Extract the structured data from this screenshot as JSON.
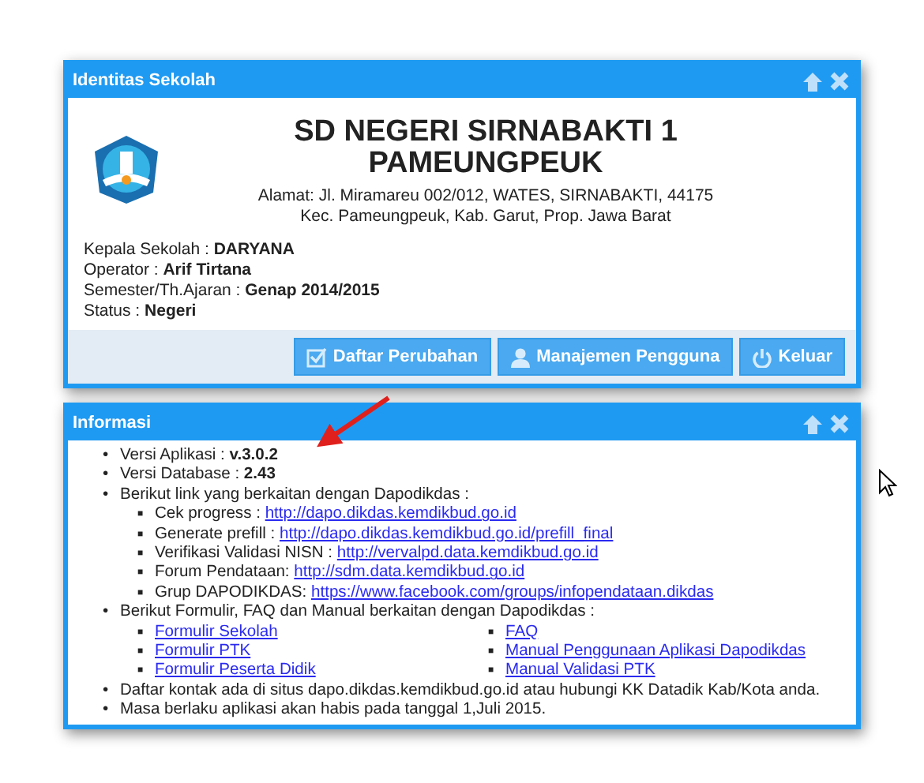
{
  "school_panel": {
    "title": "Identitas Sekolah",
    "school_name": "SD NEGERI SIRNABAKTI 1 PAMEUNGPEUK",
    "address_lines": [
      "Alamat: Jl. Miramareu 002/012, WATES, SIRNABAKTI, 44175",
      "Kec. Pameungpeuk, Kab. Garut, Prop. Jawa Barat"
    ],
    "details": [
      "Kepala Sekolah : **DARYANA**",
      "Operator : **Arif Tirtana**",
      "Semester/Th.Ajaran : **Genap 2014/2015**",
      "Status : **Negeri**"
    ],
    "buttons": [
      {
        "label": "Daftar Perubahan",
        "kind": "check"
      },
      {
        "label": "Manajemen Pengguna",
        "kind": "user"
      },
      {
        "label": "Keluar",
        "kind": "power"
      }
    ]
  },
  "info_panel": {
    "title": "Informasi",
    "items": [
      {
        "kind": "text",
        "marker": "•",
        "text": "Versi Aplikasi : **v.3.0.2**"
      },
      {
        "kind": "text",
        "marker": "•",
        "text": "Versi Database : **2.43**"
      },
      {
        "kind": "links",
        "marker": "•",
        "text": "Berikut link yang berkaitan dengan Dapodikdas :",
        "children": [
          {
            "marker": "■",
            "label": "Cek progress : ",
            "link": "http://dapo.dikdas.kemdikbud.go.id"
          },
          {
            "marker": "■",
            "label": "Generate prefill : ",
            "link": "http://dapo.dikdas.kemdikbud.go.id/prefill_final"
          },
          {
            "marker": "■",
            "label": "Verifikasi Validasi NISN : ",
            "link": "http://vervalpd.data.kemdikbud.go.id"
          },
          {
            "marker": "■",
            "label": "Forum Pendataan: ",
            "link": "http://sdm.data.kemdikbud.go.id"
          },
          {
            "marker": "■",
            "label": "Grup DAPODIKDAS: ",
            "link": "https://www.facebook.com/groups/infopendataan.dikdas"
          }
        ]
      },
      {
        "kind": "columns",
        "marker": "•",
        "text": "Berikut Formulir, FAQ dan Manual berkaitan dengan Dapodikdas :",
        "columns": [
          [
            {
              "marker": "■",
              "label": "Formulir Sekolah"
            },
            {
              "marker": "■",
              "label": "Formulir PTK"
            },
            {
              "marker": "■",
              "label": "Formulir Peserta Didik"
            }
          ],
          [
            {
              "marker": "■",
              "label": "FAQ"
            },
            {
              "marker": "■",
              "label": "Manual Penggunaan Aplikasi Dapodikdas"
            },
            {
              "marker": "■",
              "label": "Manual Validasi PTK"
            }
          ]
        ]
      },
      {
        "kind": "text",
        "marker": "•",
        "text": "Daftar kontak ada di situs dapo.dikdas.kemdikbud.go.id atau hubungi KK Datadik Kab/Kota anda."
      },
      {
        "kind": "text",
        "marker": "•",
        "text": "Masa berlaku aplikasi akan habis pada tanggal 1,Juli 2015."
      }
    ]
  }
}
